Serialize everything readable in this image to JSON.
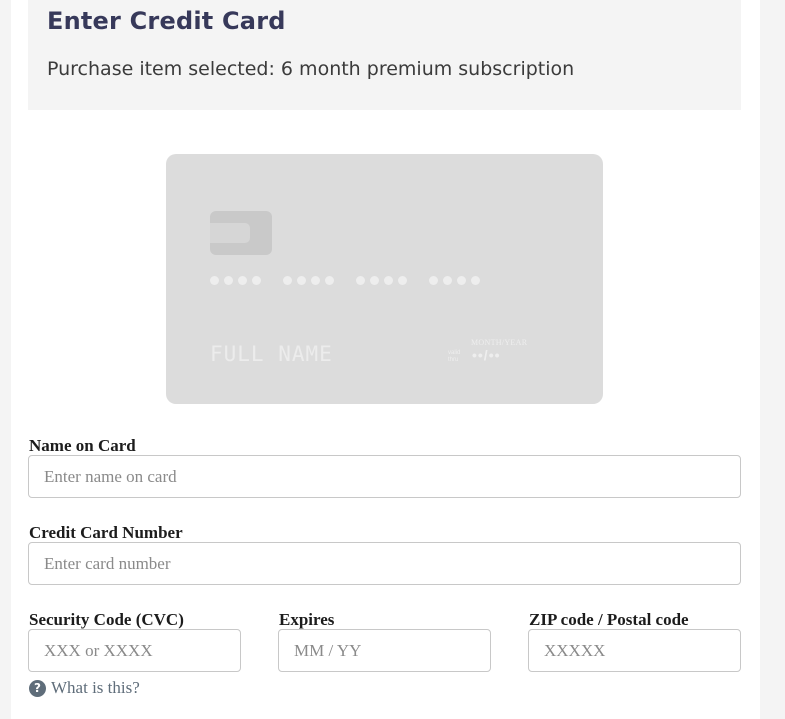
{
  "header": {
    "title": "Enter Credit Card",
    "subtitle": "Purchase item selected: 6 month premium subscription"
  },
  "card_preview": {
    "number_groups": [
      "••••",
      "••••",
      "••••",
      "••••"
    ],
    "name": "FULL NAME",
    "expiry_caption": "MONTH/YEAR",
    "valid_label": "valid thru",
    "expiry": "••/••"
  },
  "form": {
    "name_on_card": {
      "label": "Name on Card",
      "placeholder": "Enter name on card",
      "value": ""
    },
    "card_number": {
      "label": "Credit Card Number",
      "placeholder": "Enter card number",
      "value": ""
    },
    "security_code": {
      "label": "Security Code (CVC)",
      "placeholder": "XXX or XXXX",
      "value": ""
    },
    "expires": {
      "label": "Expires",
      "placeholder": "MM / YY",
      "value": ""
    },
    "zip": {
      "label": "ZIP code / Postal code",
      "placeholder": "XXXXX",
      "value": ""
    },
    "help": {
      "icon": "question-circle-icon",
      "icon_glyph": "?",
      "label": "What is this?"
    }
  },
  "colors": {
    "title": "#37395a",
    "card_background": "#dcdcdc",
    "help_link": "#5f6d7a",
    "input_border": "#c8c8c8"
  }
}
